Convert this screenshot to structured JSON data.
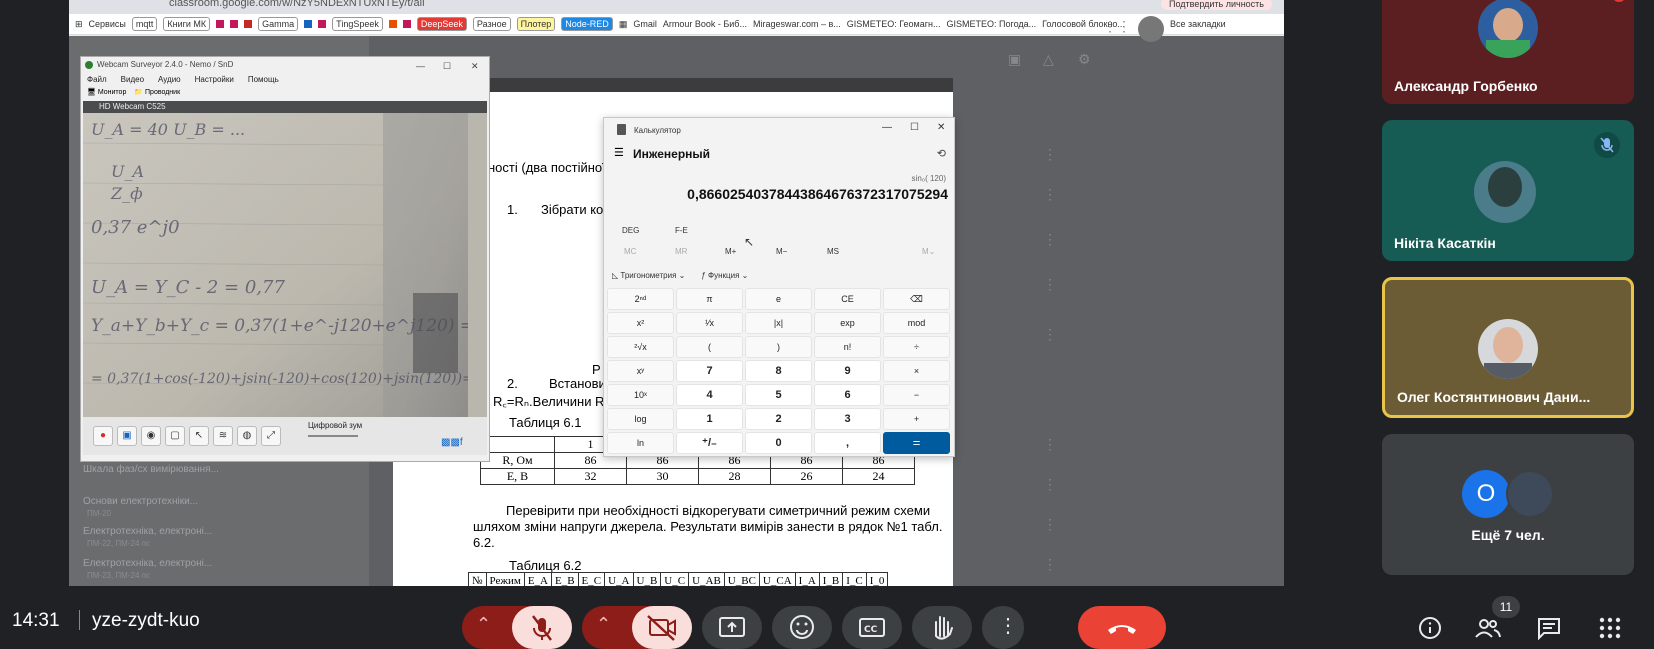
{
  "browser": {
    "url": "classroom.google.com/w/NzY5NDExNTUxNTEy/t/all",
    "verify_label": "Подтвердить личность",
    "bookmarks": [
      "Сервисы",
      "mqtt",
      "Книги МК",
      "Gamma",
      "TingSpeek",
      "DeepSeek",
      "Разное",
      "Плотер",
      "Node-RED",
      "Gmail",
      "Armour Book - Биб...",
      "Mirageswar.com – в...",
      "GISMETEO: Геомагн...",
      "GISMETEO: Погода...",
      "Голосовой блокно...",
      "Все закладки"
    ],
    "overflow": "»"
  },
  "classroom": {
    "left_items": [
      {
        "title": "Шкала фаз/сх вимірювання...",
        "sub": ""
      },
      {
        "title": "Основи електротехніки...",
        "sub": "ПМ-20"
      },
      {
        "title": "Електротехніка, електроні...",
        "sub": "ПМ-22, ПМ-24 пс"
      },
      {
        "title": "Електротехніка, електроні...",
        "sub": "ПМ-23, ПМ-24 пс"
      }
    ]
  },
  "document": {
    "line_intro": "ності (два постійної",
    "step1_num": "1.",
    "step1_text": "Зібрати кол",
    "r_label": "Р",
    "step2_num": "2.",
    "step2_text": "Встанови",
    "rr_text": "R꜀=Rₙ.Величини R та",
    "table61_title": "Таблиця 6.1",
    "table61": {
      "header": [
        "",
        "1",
        "",
        "",
        "",
        ""
      ],
      "rows": [
        [
          "R, Ом",
          "86",
          "86",
          "86",
          "86",
          "86"
        ],
        [
          "E, В",
          "32",
          "30",
          "28",
          "26",
          "24"
        ]
      ]
    },
    "paragraph": [
      "Перевірити при необхідності відкорегувати симетричний режим схеми",
      "шляхом зміни напруги джерела. Результати вимірів занести в рядок №1 табл.",
      "6.2."
    ],
    "table62_title": "Таблиця 6.2",
    "table62_header": [
      "№",
      "Режим",
      "E_A",
      "E_B",
      "E_C",
      "U_A",
      "U_B",
      "U_C",
      "U_AB",
      "U_BC",
      "U_CA",
      "I_A",
      "I_B",
      "I_C",
      "I_0"
    ]
  },
  "webcam": {
    "title": "Webcam Surveyor 2.4.0 - Nemo / SnD",
    "menu": [
      "Файл",
      "Видео",
      "Аудио",
      "Настройки",
      "Помощь"
    ],
    "tabs": [
      "Монитор",
      "Проводник"
    ],
    "camera_label": "HD Webcam C525",
    "zoom_label": "Цифровой зум",
    "handwriting": [
      "U_A = 40  U_B = ...",
      "U_A",
      "Z_ф",
      "0,37 e^j0",
      "U_A = Y_C - 2 = 0,77",
      "Y_a+Y_b+Y_c = 0,37(1+e^-j120+e^j120) =",
      "= 0,37(1+cos(-120)+jsin(-120)+cos(120)+jsin(120))="
    ]
  },
  "calculator": {
    "title": "Калькулятор",
    "mode": "Инженерный",
    "expression": "sin₀( 120)",
    "result": "0,86602540378443864676372317075294",
    "angle_unit": "DEG",
    "fe": "F-E",
    "memory": [
      "MC",
      "MR",
      "M+",
      "M−",
      "MS",
      "M⌄"
    ],
    "trig_label": "Тригонометрия",
    "func_label": "Функция",
    "keys": [
      [
        "2ⁿᵈ",
        "π",
        "e",
        "CE",
        "⌫"
      ],
      [
        "x²",
        "¹⁄x",
        "|x|",
        "exp",
        "mod"
      ],
      [
        "²√x",
        "(",
        ")",
        "n!",
        "÷"
      ],
      [
        "xʸ",
        "7",
        "8",
        "9",
        "×"
      ],
      [
        "10ˣ",
        "4",
        "5",
        "6",
        "−"
      ],
      [
        "log",
        "1",
        "2",
        "3",
        "+"
      ],
      [
        "ln",
        "⁺/₋",
        "0",
        ",",
        "="
      ]
    ]
  },
  "meet": {
    "participants": [
      {
        "name": "Александр Горбенко"
      },
      {
        "name": "Нікіта Касаткін"
      },
      {
        "name": "Олег Костянтинович Дани..."
      }
    ],
    "more_initial": "О",
    "more_label": "Ещё 7 чел.",
    "time": "14:31",
    "meeting_code": "yze-zydt-kuo",
    "participants_count": "11",
    "colors": {
      "end_call": "#ea4335",
      "muted_bg": "#f9dedc",
      "muted_dark": "#8c1d18",
      "speaking_border": "#e8c44a"
    }
  }
}
